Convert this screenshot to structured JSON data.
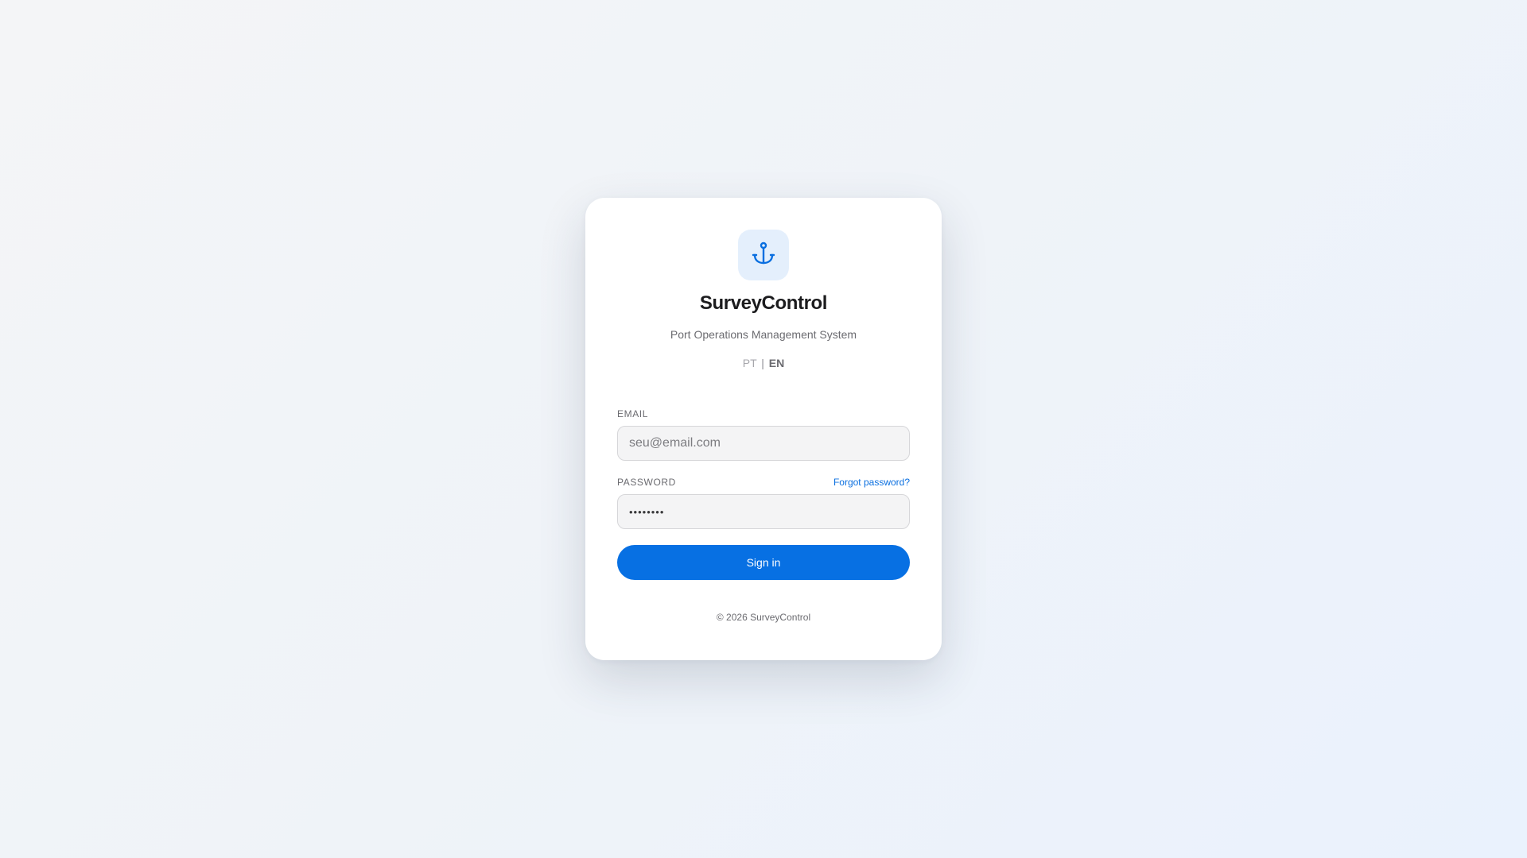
{
  "app": {
    "title": "SurveyControl",
    "subtitle": "Port Operations Management System",
    "logo_icon": "anchor-icon"
  },
  "language": {
    "options": [
      "PT",
      "EN"
    ],
    "separator": "|",
    "selected": "EN"
  },
  "form": {
    "email_label": "EMAIL",
    "email_placeholder": "seu@email.com",
    "email_value": "",
    "password_label": "PASSWORD",
    "password_value": "••••••••",
    "forgot_label": "Forgot password?",
    "submit_label": "Sign in"
  },
  "footer": {
    "copyright": "© 2026 SurveyControl"
  },
  "colors": {
    "accent": "#0770e3",
    "link": "#0a6fe0",
    "logo_bg": "#e4effc",
    "card_bg": "#ffffff"
  }
}
